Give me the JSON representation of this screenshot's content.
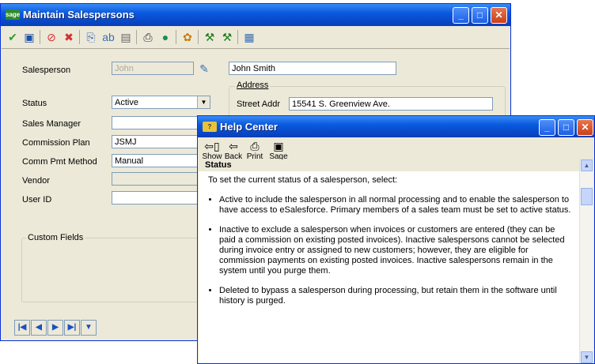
{
  "main_window": {
    "title": "Maintain Salespersons",
    "app_badge": "sage",
    "toolbar_icons": [
      "accept-icon",
      "save-icon",
      "delete-icon",
      "cancel-icon",
      "copy-icon",
      "rename-icon",
      "memo-icon",
      "print-icon",
      "help-icon",
      "color-icon",
      "custom-icon",
      "custom2-icon",
      "calculator-icon"
    ],
    "salesperson_label": "Salesperson",
    "salesperson_value": "John",
    "salesperson_name": "John Smith",
    "address_group": "Address",
    "street_label": "Street Addr",
    "street_value": "15541 S. Greenview Ave.",
    "status_label": "Status",
    "status_value": "Active",
    "sales_manager_label": "Sales Manager",
    "sales_manager_value": "",
    "commission_plan_label": "Commission Plan",
    "commission_plan_value": "JSMJ",
    "comm_pmt_method_label": "Comm Pmt Method",
    "comm_pmt_method_value": "Manual",
    "vendor_label": "Vendor",
    "vendor_value": "",
    "user_id_label": "User ID",
    "user_id_value": "",
    "custom_fields_label": "Custom Fields"
  },
  "help_window": {
    "title": "Help Center",
    "buttons": {
      "show": "Show",
      "back": "Back",
      "print": "Print",
      "sage": "Sage"
    },
    "heading": "Status",
    "intro": "To set the current status of a salesperson, select:",
    "bullets": [
      "Active to include the salesperson in all normal processing and to enable the salesperson to have access to eSalesforce. Primary members of a sales team must be set to active status.",
      "Inactive to exclude a salesperson when invoices or customers are entered (they can be paid a commission on existing posted invoices). Inactive salespersons cannot be selected during invoice entry or assigned to new customers; however, they are eligible for commission payments on existing posted invoices. Inactive salespersons remain in the system until you purge them.",
      "Deleted to bypass a salesperson during processing, but retain them in the software until history is purged."
    ]
  },
  "colors": {
    "titlebar": "#0a5ae0",
    "window_bg": "#ece9d8",
    "border": "#0831d9"
  }
}
